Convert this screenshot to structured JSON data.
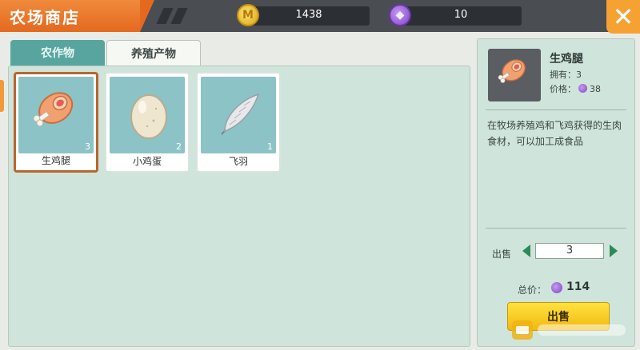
{
  "header": {
    "title": "农场商店",
    "gold": {
      "icon": "gold-coin-icon",
      "value": "1438"
    },
    "gems": {
      "icon": "purple-gem-icon",
      "value": "10"
    },
    "close_icon": "close-icon"
  },
  "tabs": [
    {
      "label": "农作物",
      "active": false
    },
    {
      "label": "养殖产物",
      "active": true
    }
  ],
  "items": [
    {
      "name": "生鸡腿",
      "count": "3",
      "icon": "chicken-leg-icon",
      "selected": true
    },
    {
      "name": "小鸡蛋",
      "count": "2",
      "icon": "egg-icon",
      "selected": false
    },
    {
      "name": "飞羽",
      "count": "1",
      "icon": "feather-icon",
      "selected": false
    }
  ],
  "detail": {
    "name": "生鸡腿",
    "owned_label": "拥有：3",
    "price_label": "价格：",
    "price_value": "38",
    "description": "在牧场养殖鸡和飞鸡获得的生肉食材，可以加工成食品"
  },
  "sell": {
    "label": "出售",
    "quantity": "3",
    "total_label": "总价：",
    "total_value": "114",
    "button_label": "出售"
  },
  "colors": {
    "title_orange": "#e4691f",
    "panel_green": "#cfe4da",
    "item_teal": "#8cc3c6",
    "active_tab": "#58a5a0",
    "sell_button": "#f1b90e"
  }
}
